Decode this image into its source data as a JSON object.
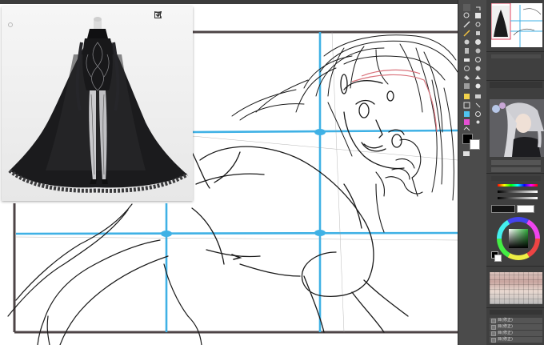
{
  "canvas": {
    "guide_color": "#3fb1e5",
    "frame_color": "#4d4446"
  },
  "reference_window": {
    "tools": [
      {
        "name": "expand-icon",
        "label": "⛶"
      },
      {
        "name": "open-external-icon",
        "label": "⧉"
      },
      {
        "name": "download-icon",
        "label": "⤓"
      }
    ]
  },
  "right_panel": {
    "layers": [
      {
        "label": "目(修正)"
      },
      {
        "label": "目(修正)"
      },
      {
        "label": "目(修正)"
      },
      {
        "label": "目(修正)"
      }
    ]
  },
  "colors": {
    "main_color": "#000000",
    "sub_color": "#ffffff",
    "accent": "#3fb1e5"
  }
}
